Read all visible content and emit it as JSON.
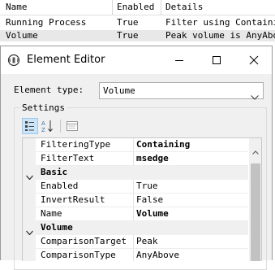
{
  "background_table": {
    "headers": [
      "Name",
      "Enabled",
      "Details"
    ],
    "rows": [
      [
        "Running Process",
        "True",
        "Filter using Containin..."
      ],
      [
        "Volume",
        "True",
        "Peak volume is AnyAbov..."
      ]
    ]
  },
  "dialog": {
    "title": "Element Editor",
    "element_type_label": "Element type:",
    "element_type_value": "Volume",
    "settings_label": "Settings",
    "toolbar": {
      "categorized_icon": "categorized-icon",
      "alphabetical_icon": "alphabetical-icon",
      "property_pages_icon": "property-pages-icon"
    },
    "properties": {
      "filtering_type": {
        "name": "FilteringType",
        "value": "Containing"
      },
      "filter_text": {
        "name": "FilterText",
        "value": "msedge"
      },
      "basic_category": "Basic",
      "enabled": {
        "name": "Enabled",
        "value": "True"
      },
      "invert_result": {
        "name": "InvertResult",
        "value": "False"
      },
      "name": {
        "name": "Name",
        "value": "Volume"
      },
      "volume_category": "Volume",
      "comparison_target": {
        "name": "ComparisonTarget",
        "value": "Peak"
      },
      "comparison_type": {
        "name": "ComparisonType",
        "value": "AnyAbove"
      }
    }
  },
  "colors": {
    "selected_row_bg": "#e8e8e8",
    "active_tool_bg": "#cce4f7",
    "grid_gutter": "#f0f0f0"
  }
}
